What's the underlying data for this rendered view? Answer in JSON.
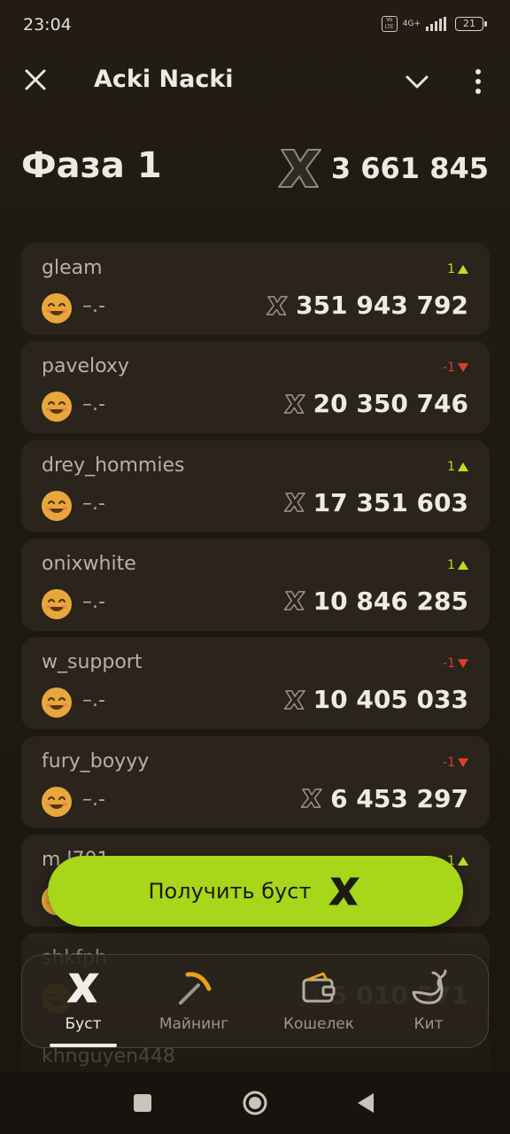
{
  "status_bar": {
    "time": "23:04",
    "volte": "Vo LTE",
    "network": "4G+",
    "battery": "21"
  },
  "top_bar": {
    "title": "Acki Nacki",
    "icons": [
      "close-icon",
      "chevron-down-icon",
      "more-vertical-icon"
    ]
  },
  "phase": {
    "title": "Фаза 1",
    "total": "3 661 845",
    "currency_icon": "x-token-icon"
  },
  "colors": {
    "accent": "#a8d61a",
    "up": "#b7e024",
    "down": "#e23a30",
    "card_bg": "#2a241c",
    "background": "#1e1913"
  },
  "leaderboard": [
    {
      "name": "gleam",
      "change": "1",
      "direction": "up",
      "boost": "–.-",
      "score": "351 943 792"
    },
    {
      "name": "paveloxy",
      "change": "-1",
      "direction": "down",
      "boost": "–.-",
      "score": "20 350 746"
    },
    {
      "name": "drey_hommies",
      "change": "1",
      "direction": "up",
      "boost": "–.-",
      "score": "17 351 603"
    },
    {
      "name": "onixwhite",
      "change": "1",
      "direction": "up",
      "boost": "–.-",
      "score": "10 846 285"
    },
    {
      "name": "w_support",
      "change": "-1",
      "direction": "down",
      "boost": "–.-",
      "score": "10 405 033"
    },
    {
      "name": "fury_boyyy",
      "change": "-1",
      "direction": "down",
      "boost": "–.-",
      "score": "6 453 297"
    },
    {
      "name": "m.l701",
      "change": "1",
      "direction": "up",
      "boost": "–.-",
      "score": ""
    },
    {
      "name": "shkfph",
      "change": "",
      "direction": "down",
      "boost": "",
      "score": "5 010 571"
    },
    {
      "name": "khnguyen448",
      "change": "",
      "direction": "down",
      "boost": "",
      "score": ""
    }
  ],
  "cta": {
    "label": "Получить буст"
  },
  "bottom_nav": {
    "items": [
      {
        "label": "Буст",
        "icon": "x-token-icon",
        "active": true
      },
      {
        "label": "Майнинг",
        "icon": "pickaxe-icon",
        "active": false
      },
      {
        "label": "Кошелек",
        "icon": "wallet-icon",
        "active": false
      },
      {
        "label": "Кит",
        "icon": "whale-icon",
        "active": false
      }
    ]
  },
  "system_nav": [
    "recents-square-icon",
    "home-circle-icon",
    "back-triangle-icon"
  ]
}
